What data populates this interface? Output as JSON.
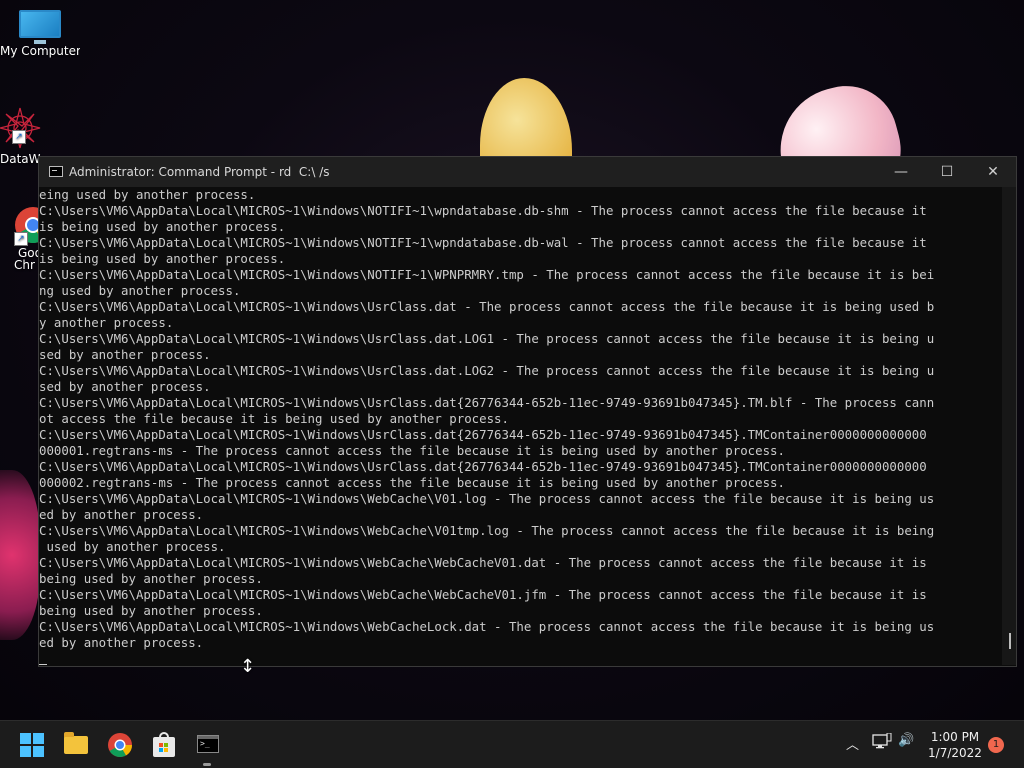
{
  "desktop": {
    "icons": [
      {
        "label": "My Computer"
      },
      {
        "label": "DataW"
      },
      {
        "label": "Goo"
      },
      {
        "label": "Chr"
      }
    ]
  },
  "window": {
    "title": "Administrator: Command Prompt - rd  C:\\ /s",
    "minimize_glyph": "—",
    "maximize_glyph": "☐",
    "close_glyph": "✕"
  },
  "console": {
    "lines": [
      "eing used by another process.",
      "C:\\Users\\VM6\\AppData\\Local\\MICROS~1\\Windows\\NOTIFI~1\\wpndatabase.db-shm - The process cannot access the file because it",
      "is being used by another process.",
      "C:\\Users\\VM6\\AppData\\Local\\MICROS~1\\Windows\\NOTIFI~1\\wpndatabase.db-wal - The process cannot access the file because it",
      "is being used by another process.",
      "C:\\Users\\VM6\\AppData\\Local\\MICROS~1\\Windows\\NOTIFI~1\\WPNPRMRY.tmp - The process cannot access the file because it is bei",
      "ng used by another process.",
      "C:\\Users\\VM6\\AppData\\Local\\MICROS~1\\Windows\\UsrClass.dat - The process cannot access the file because it is being used b",
      "y another process.",
      "C:\\Users\\VM6\\AppData\\Local\\MICROS~1\\Windows\\UsrClass.dat.LOG1 - The process cannot access the file because it is being u",
      "sed by another process.",
      "C:\\Users\\VM6\\AppData\\Local\\MICROS~1\\Windows\\UsrClass.dat.LOG2 - The process cannot access the file because it is being u",
      "sed by another process.",
      "C:\\Users\\VM6\\AppData\\Local\\MICROS~1\\Windows\\UsrClass.dat{26776344-652b-11ec-9749-93691b047345}.TM.blf - The process cann",
      "ot access the file because it is being used by another process.",
      "C:\\Users\\VM6\\AppData\\Local\\MICROS~1\\Windows\\UsrClass.dat{26776344-652b-11ec-9749-93691b047345}.TMContainer0000000000000",
      "000001.regtrans-ms - The process cannot access the file because it is being used by another process.",
      "C:\\Users\\VM6\\AppData\\Local\\MICROS~1\\Windows\\UsrClass.dat{26776344-652b-11ec-9749-93691b047345}.TMContainer0000000000000",
      "000002.regtrans-ms - The process cannot access the file because it is being used by another process.",
      "C:\\Users\\VM6\\AppData\\Local\\MICROS~1\\Windows\\WebCache\\V01.log - The process cannot access the file because it is being us",
      "ed by another process.",
      "C:\\Users\\VM6\\AppData\\Local\\MICROS~1\\Windows\\WebCache\\V01tmp.log - The process cannot access the file because it is being",
      " used by another process.",
      "C:\\Users\\VM6\\AppData\\Local\\MICROS~1\\Windows\\WebCache\\WebCacheV01.dat - The process cannot access the file because it is",
      "being used by another process.",
      "C:\\Users\\VM6\\AppData\\Local\\MICROS~1\\Windows\\WebCache\\WebCacheV01.jfm - The process cannot access the file because it is",
      "being used by another process.",
      "C:\\Users\\VM6\\AppData\\Local\\MICROS~1\\Windows\\WebCacheLock.dat - The process cannot access the file because it is being us",
      "ed by another process."
    ]
  },
  "taskbar": {
    "apps": [
      "start-icon",
      "file-explorer-icon",
      "chrome-icon",
      "store-icon",
      "command-prompt-icon"
    ],
    "tray_icons": [
      "chevron-up-icon",
      "network-icon",
      "volume-icon"
    ],
    "chevron_glyph": "︿",
    "volume_glyph": "🔊",
    "time": "1:00 PM",
    "date": "1/7/2022",
    "notification_count": "1"
  }
}
